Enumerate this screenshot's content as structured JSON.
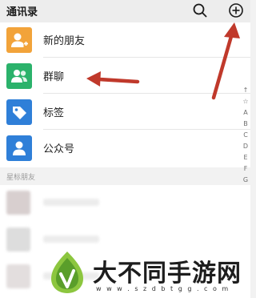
{
  "header": {
    "title": "通讯录"
  },
  "contact_entries": [
    {
      "label": "新的朋友",
      "icon": "add-friend-icon",
      "color": "#f2a33a"
    },
    {
      "label": "群聊",
      "icon": "group-chat-icon",
      "color": "#2bb26b"
    },
    {
      "label": "标签",
      "icon": "tag-icon",
      "color": "#2f7fd8"
    },
    {
      "label": "公众号",
      "icon": "official-account-icon",
      "color": "#2f7fd8"
    }
  ],
  "section": {
    "starred_label": "星标朋友"
  },
  "index_letters": [
    "↑",
    "☆",
    "A",
    "B",
    "C",
    "D",
    "E",
    "F",
    "G"
  ],
  "annotations": {
    "arrow_color": "#c0392b"
  },
  "watermark": {
    "text": "大不同手游网",
    "url": "w w w . s z d b t g g . c o m"
  }
}
